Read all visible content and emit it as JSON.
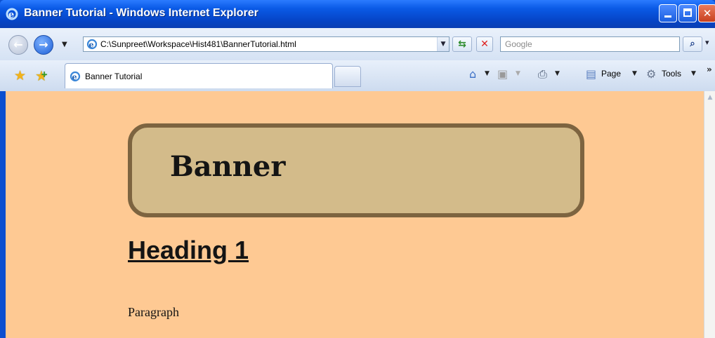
{
  "window": {
    "title": "Banner Tutorial - Windows Internet Explorer"
  },
  "nav": {
    "address_url": "C:\\Sunpreet\\Workspace\\Hist481\\BannerTutorial.html",
    "search_placeholder": "Google"
  },
  "tabs": [
    {
      "label": "Banner Tutorial"
    }
  ],
  "command_bar": {
    "page_label": "Page",
    "tools_label": "Tools"
  },
  "page": {
    "banner_title": "Banner",
    "heading1": "Heading 1",
    "paragraph": "Paragraph"
  },
  "colors": {
    "page_background": "#fec993",
    "banner_fill": "#d3bb8a",
    "banner_border": "#7d6440"
  }
}
